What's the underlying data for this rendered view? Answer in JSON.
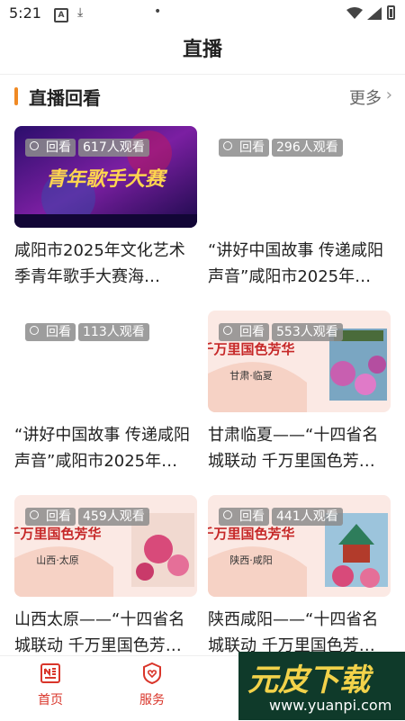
{
  "status": {
    "time": "5:21"
  },
  "header": {
    "title": "直播"
  },
  "section": {
    "title": "直播回看",
    "more": "更多"
  },
  "cards": [
    {
      "badge_replay": "回看",
      "viewers": "617人观看",
      "title": "咸阳市2025年文化艺术季青年歌手大赛海…",
      "thumb_text": "青年歌手大赛"
    },
    {
      "badge_replay": "回看",
      "viewers": "296人观看",
      "title": "“讲好中国故事 传递咸阳声音”咸阳市2025年…"
    },
    {
      "badge_replay": "回看",
      "viewers": "113人观看",
      "title": "“讲好中国故事 传递咸阳声音”咸阳市2025年…"
    },
    {
      "badge_replay": "回看",
      "viewers": "553人观看",
      "title": "甘肃临夏——“十四省名城联动 千万里国色芳…",
      "thumb_text": "千万里国色芳华",
      "thumb_place": "甘肃·临夏"
    },
    {
      "badge_replay": "回看",
      "viewers": "459人观看",
      "title": "山西太原——“十四省名城联动 千万里国色芳…",
      "thumb_text": "千万里国色芳华",
      "thumb_place": "山西·太原"
    },
    {
      "badge_replay": "回看",
      "viewers": "441人观看",
      "title": "陕西咸阳——“十四省名城联动 千万里国色芳…",
      "thumb_text": "千万里国色芳华",
      "thumb_place": "陕西·咸阳"
    }
  ],
  "tabs": [
    {
      "label": "首页",
      "icon": "home-news-icon"
    },
    {
      "label": "服务",
      "icon": "service-heart-icon"
    }
  ],
  "watermark": {
    "text": "元皮下载",
    "url": "www.yuanpi.com"
  },
  "colors": {
    "accent": "#f08a24",
    "tab_active": "#d9352a"
  }
}
